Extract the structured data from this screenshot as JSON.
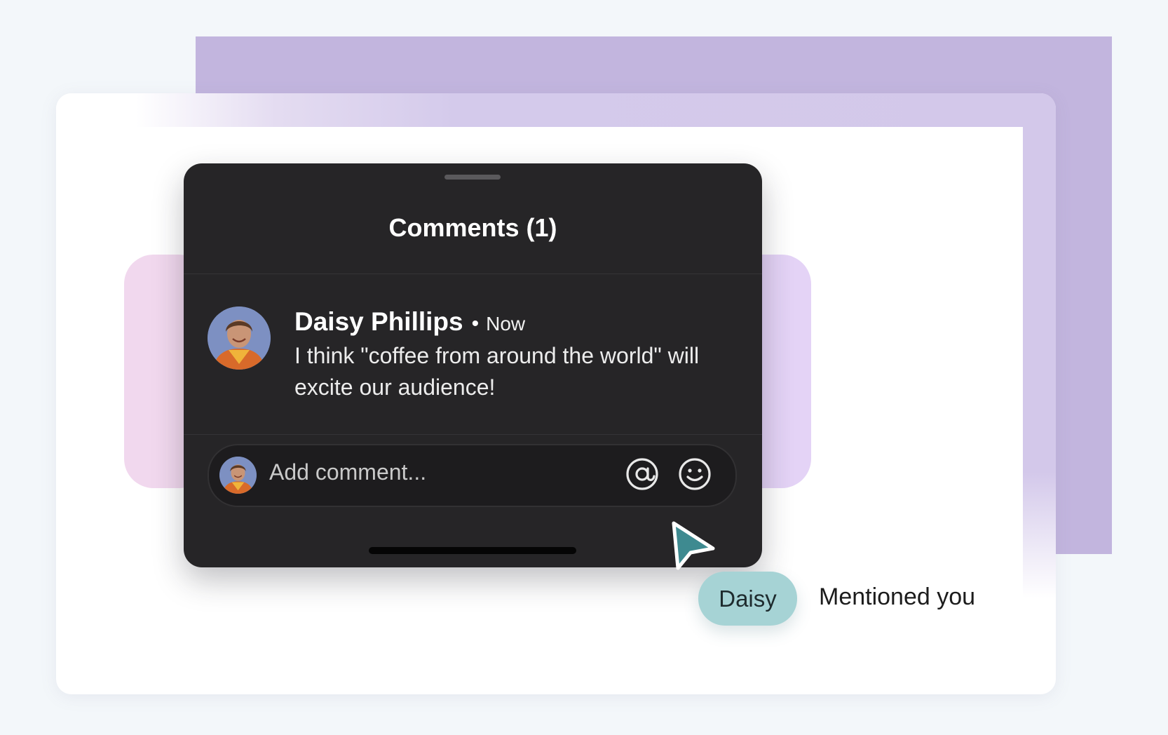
{
  "panel": {
    "title": "Comments (1)"
  },
  "comment": {
    "author": "Daisy Phillips",
    "separator": "•",
    "time": "Now",
    "text": "I think \"coffee from around the world\" will excite our audience!"
  },
  "composer": {
    "placeholder": "Add comment...",
    "icons": [
      "at-mention-icon",
      "emoji-icon"
    ]
  },
  "mention": {
    "chip": "Daisy",
    "text": "Mentioned you"
  },
  "colors": {
    "panel_bg": "#262527",
    "chip_bg": "#a6d3d5",
    "cursor": "#3e8a90",
    "purple": "#c2b5de"
  }
}
